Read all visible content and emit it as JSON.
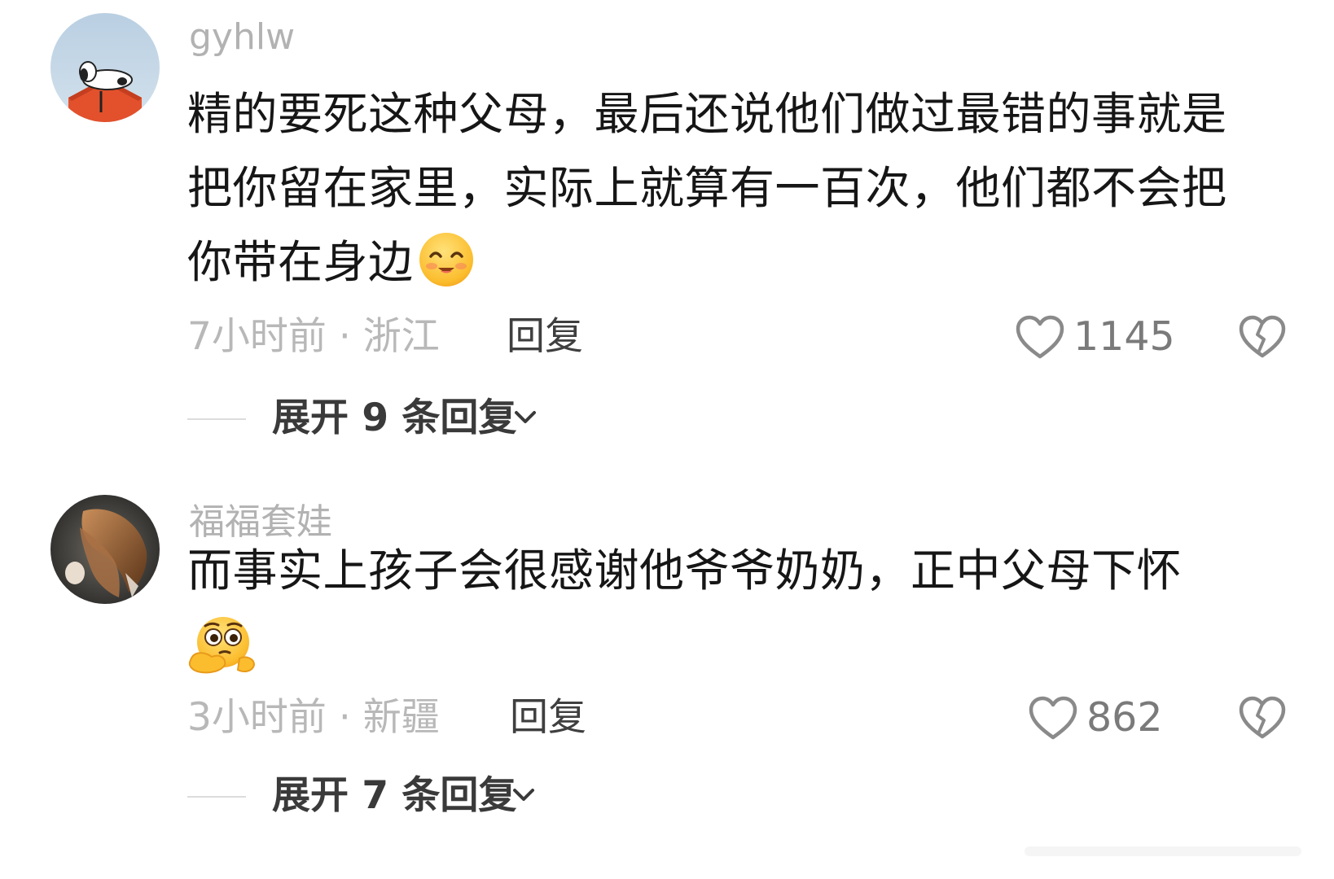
{
  "comments": [
    {
      "username": "gyhlw",
      "text_lines": [
        "精的要死这种父母，最后还说他们做过最错的事就是",
        "把你留在家里，实际上就算有一百次，他们都不会把",
        "你带在身边"
      ],
      "emoji": "smiling-face-emoji",
      "time_location": "7小时前 · 浙江",
      "reply_label": "回复",
      "like_count": "1145",
      "expand_label": "展开 9 条回复"
    },
    {
      "username": "福福套娃",
      "text_lines": [
        "而事实上孩子会很感谢他爷爷奶奶，正中父母下怀"
      ],
      "emoji": "thinking-face-emoji",
      "time_location": "3小时前 · 新疆",
      "reply_label": "回复",
      "like_count": "862",
      "expand_label": "展开 7 条回复"
    }
  ],
  "colors": {
    "background": "#ffffff",
    "username": "#b2b2b2",
    "body_text": "#161616",
    "meta_text": "#b8b8b8",
    "reply_text": "#3f3f3f",
    "icon_gray": "#8a8a8a"
  }
}
